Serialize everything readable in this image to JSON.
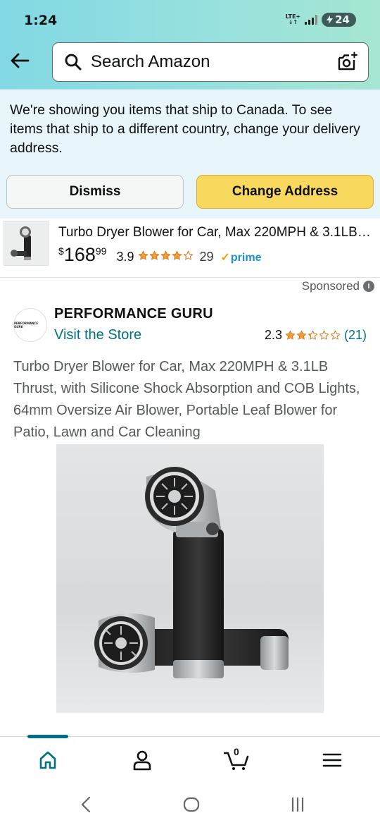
{
  "status_bar": {
    "time": "1:24",
    "network": "LTE+",
    "battery": "24"
  },
  "search": {
    "placeholder": "Search Amazon"
  },
  "ship_banner": {
    "message": "We're showing you items that ship to Canada. To see items that ship to a different country, change your delivery address.",
    "dismiss_label": "Dismiss",
    "change_address_label": "Change Address"
  },
  "sticky_product": {
    "title": "Turbo Dryer Blower for Car, Max 220MPH & 3.1LB Thrust",
    "price_symbol": "$",
    "price_whole": "168",
    "price_fraction": "99",
    "rating": "3.9",
    "rating_value": 3.9,
    "review_count": "29",
    "prime_label": "prime"
  },
  "sponsored_label": "Sponsored",
  "brand": {
    "name": "PERFORMANCE GURU",
    "logo_text": "PERFORMANCE GURU",
    "visit_store_label": "Visit the Store",
    "rating": "2.3",
    "rating_value": 2.3,
    "review_count": "(21)"
  },
  "product": {
    "title": "Turbo Dryer Blower for Car, Max 220MPH & 3.1LB Thrust, with Silicone Shock Absorption and COB Lights, 64mm Oversize Air Blower, Portable Leaf Blower for Patio, Lawn and Car Cleaning"
  },
  "bottom_nav": {
    "items": [
      {
        "name": "home",
        "icon": "home-icon",
        "active": true
      },
      {
        "name": "account",
        "icon": "person-icon",
        "active": false
      },
      {
        "name": "cart",
        "icon": "cart-icon",
        "active": false
      },
      {
        "name": "menu",
        "icon": "hamburger-menu-icon",
        "active": false
      }
    ],
    "cart_count": "0"
  },
  "colors": {
    "header_gradient_start": "#82d8e3",
    "banner_bg": "#e8f6fb",
    "change_button": "#f8d95e",
    "link": "#007185",
    "star": "#f19e39",
    "prime": "#1a8fd6"
  }
}
